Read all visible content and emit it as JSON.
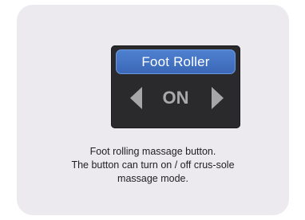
{
  "control": {
    "button_label": "Foot Roller",
    "state_value": "ON",
    "left_arrow_icon": "triangle-left-icon",
    "right_arrow_icon": "triangle-right-icon"
  },
  "description": {
    "lines": [
      "Foot rolling massage button.",
      "The button can turn on / off crus-sole",
      "massage mode."
    ]
  },
  "colors": {
    "card_background": "#eceaef",
    "control_background": "#2a2a2c",
    "button_blue": "#4677c6",
    "arrow_gray": "#a7a7a9",
    "text_dark": "#1f1f1f"
  }
}
